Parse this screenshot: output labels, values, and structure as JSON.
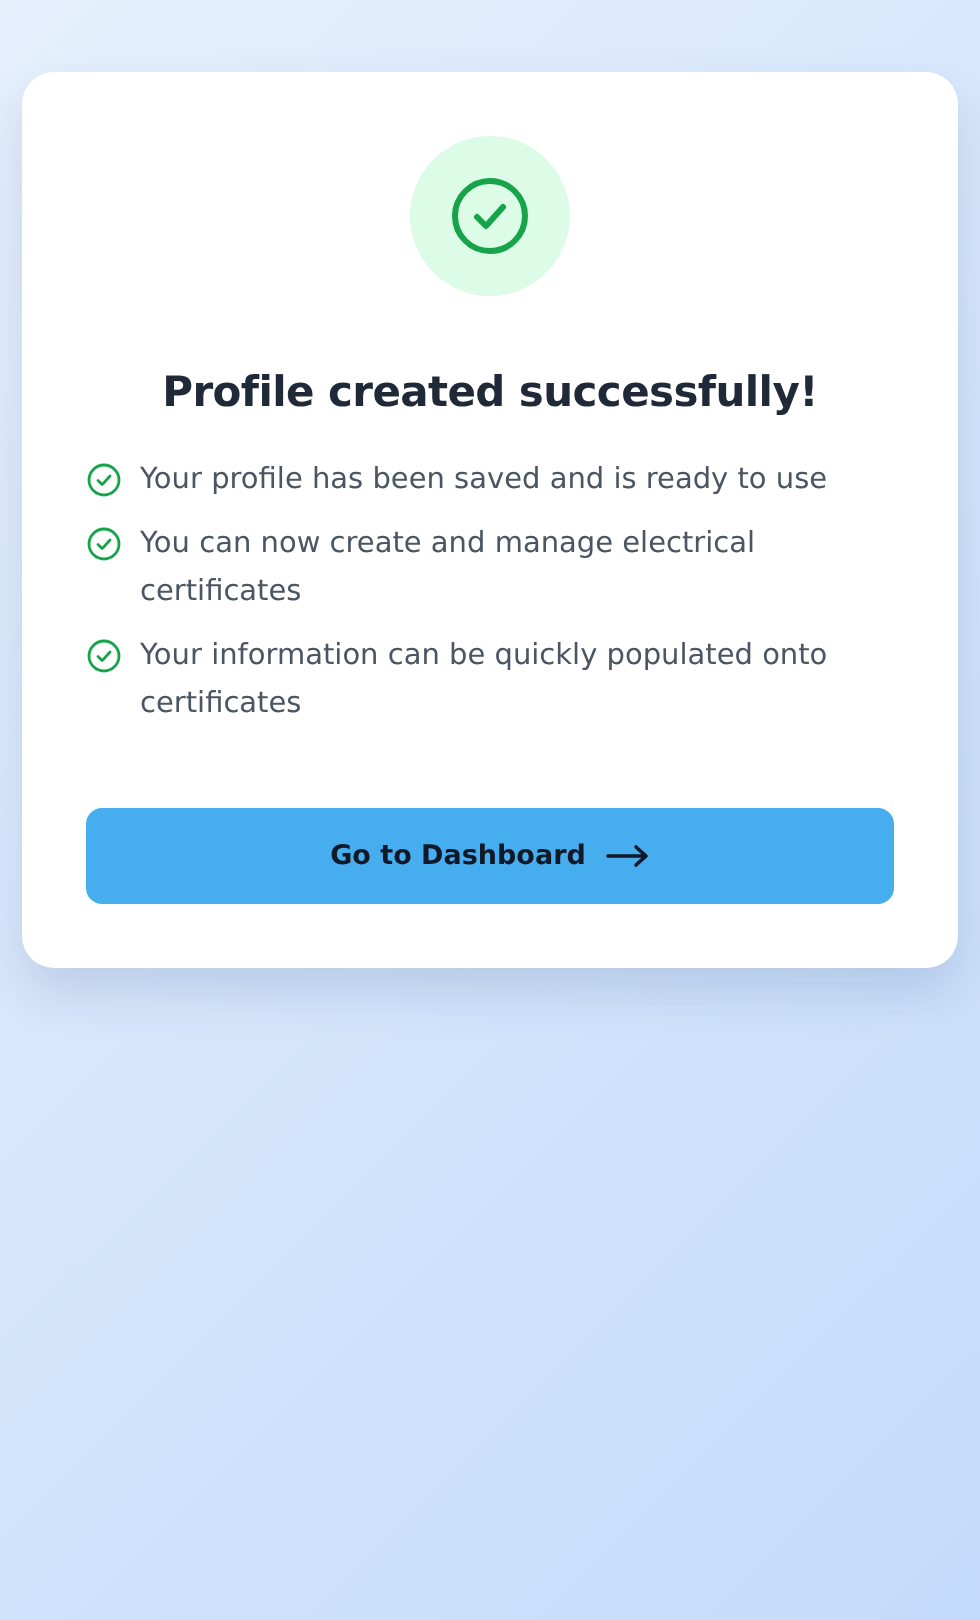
{
  "title": "Profile created successfully!",
  "points": [
    {
      "text": "Your profile has been saved and is ready to use"
    },
    {
      "text": "You can now create and manage electrical certificates"
    },
    {
      "text": "Your information can be quickly populated onto certificates"
    }
  ],
  "button": {
    "label": "Go to Dashboard"
  }
}
